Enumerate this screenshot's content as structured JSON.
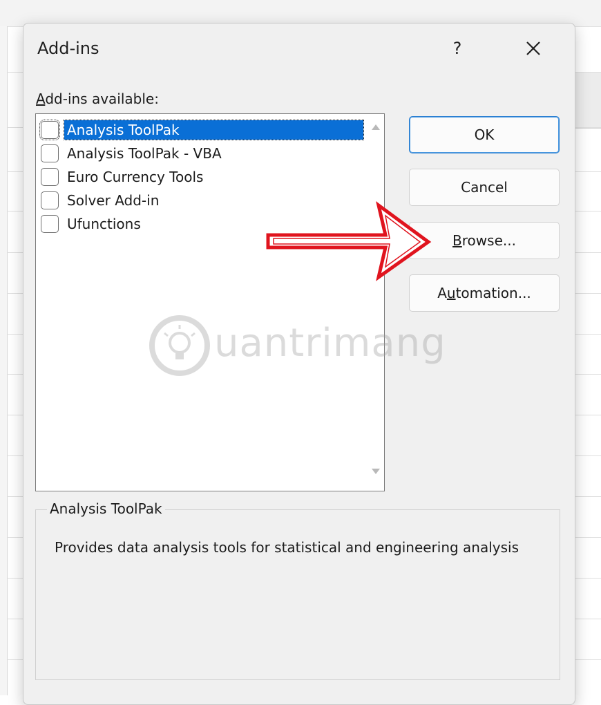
{
  "dialog": {
    "title": "Add-ins",
    "help_label": "?",
    "close_icon": "close-icon"
  },
  "list": {
    "label_mnemonic": "A",
    "label_rest": "dd-ins available:",
    "items": [
      {
        "label": "Analysis ToolPak",
        "checked": false,
        "selected": true
      },
      {
        "label": "Analysis ToolPak - VBA",
        "checked": false,
        "selected": false
      },
      {
        "label": "Euro Currency Tools",
        "checked": false,
        "selected": false
      },
      {
        "label": "Solver Add-in",
        "checked": false,
        "selected": false
      },
      {
        "label": "Ufunctions",
        "checked": false,
        "selected": false
      }
    ]
  },
  "buttons": {
    "ok": "OK",
    "cancel": "Cancel",
    "browse_mnemonic": "B",
    "browse_rest": "rowse...",
    "automation_pre": "A",
    "automation_mnemonic": "u",
    "automation_rest": "tomation..."
  },
  "description": {
    "title": "Analysis ToolPak",
    "text": "Provides data analysis tools for statistical and engineering analysis"
  },
  "watermark": {
    "text": "uantrimang"
  },
  "colors": {
    "selection": "#0a6fd6",
    "annotation_arrow": "#e0141e",
    "dialog_bg": "#f0f0f0",
    "primary_border": "#2a7fd1"
  }
}
